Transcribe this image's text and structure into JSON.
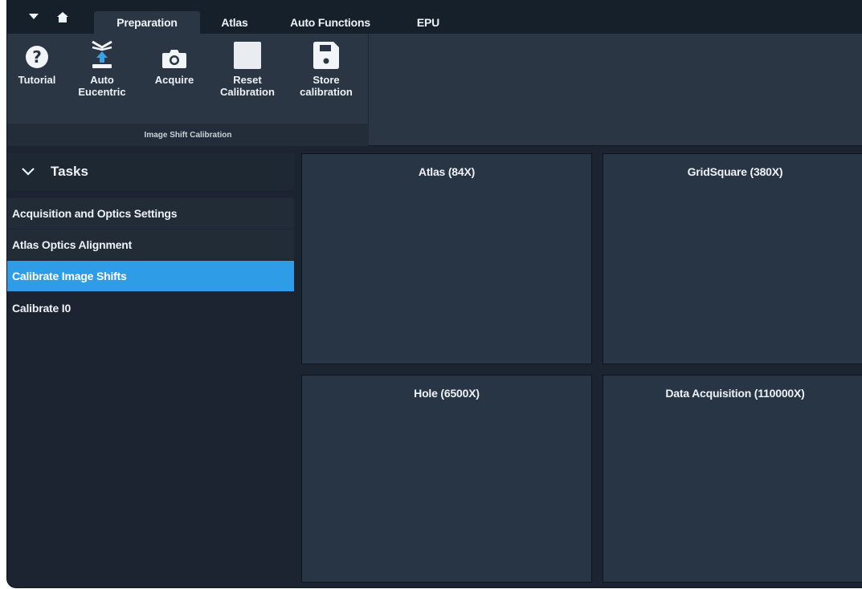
{
  "tabbar": {
    "menu_icon": "caret-down-icon",
    "home_icon": "home-icon",
    "tabs": [
      {
        "label": "Preparation",
        "active": true
      },
      {
        "label": "Atlas",
        "active": false
      },
      {
        "label": "Auto Functions",
        "active": false
      },
      {
        "label": "EPU",
        "active": false
      }
    ]
  },
  "ribbon": {
    "buttons": [
      {
        "label": "Tutorial",
        "icon": "help-icon"
      },
      {
        "label": "Auto\nEucentric",
        "icon": "eucentric-icon"
      },
      {
        "label": "Acquire",
        "icon": "camera-icon"
      },
      {
        "label": "Reset\nCalibration",
        "icon": "reset-square-icon"
      },
      {
        "label": "Store\ncalibration",
        "icon": "save-icon"
      }
    ],
    "group_label": "Image Shift Calibration"
  },
  "tasks": {
    "title": "Tasks",
    "items": [
      {
        "label": "Acquisition and Optics Settings",
        "selected": false
      },
      {
        "label": "Atlas Optics Alignment",
        "selected": false
      },
      {
        "label": "Calibrate Image Shifts",
        "selected": true
      },
      {
        "label": "Calibrate I0",
        "selected": false
      }
    ]
  },
  "panes": [
    {
      "title": "Atlas (84X)"
    },
    {
      "title": "GridSquare (380X)"
    },
    {
      "title": "Hole (6500X)"
    },
    {
      "title": "Data Acquisition (110000X)"
    }
  ],
  "colors": {
    "background": "#1b2430",
    "ribbon": "#2a3644",
    "selected": "#2e9ce6",
    "pane": "#283544"
  }
}
